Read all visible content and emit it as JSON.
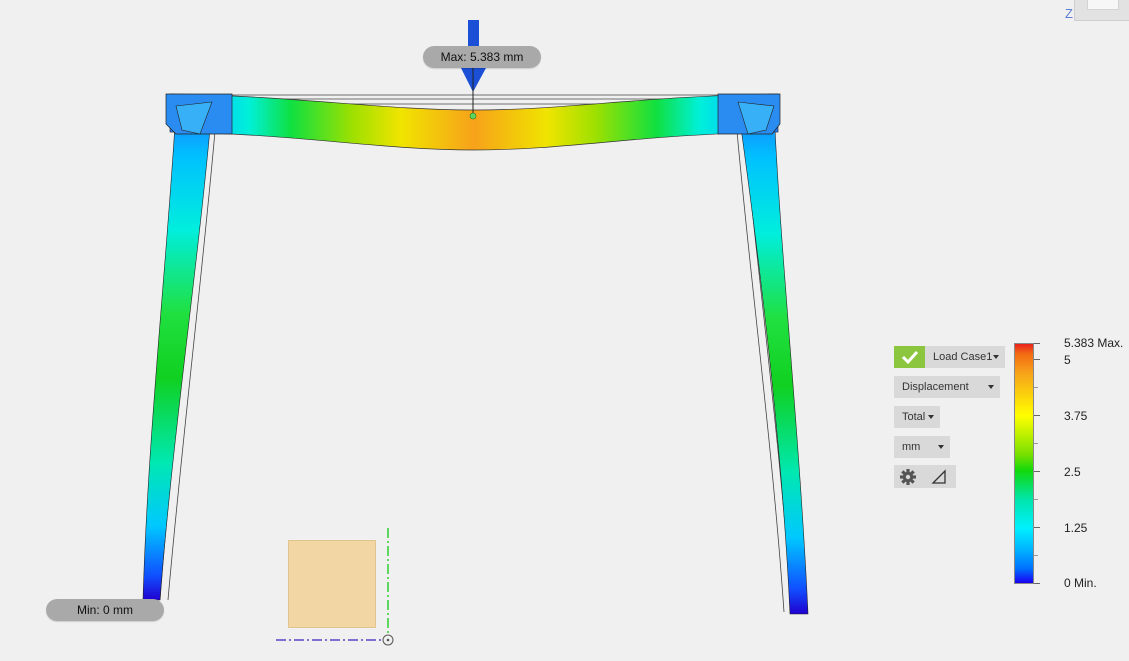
{
  "viewport": {
    "max_probe": "Max: 5.383 mm",
    "min_probe": "Min: 0 mm",
    "axis_label": "Z"
  },
  "controls": {
    "load_case": "Load Case1",
    "result_type": "Displacement",
    "component": "Total",
    "unit": "mm"
  },
  "legend": {
    "max_label": "5.383 Max.",
    "labels": [
      "5",
      "3.75",
      "2.5",
      "1.25"
    ],
    "min_label": "0 Min.",
    "colors": {
      "max": "#e8211c",
      "high": "#ffff00",
      "mid": "#12d80c",
      "low": "#00f0ff",
      "min": "#1a00f0"
    }
  },
  "icons": {
    "load_arrow": "down-arrow-icon",
    "settings": "gear-icon",
    "deform_scale": "triangle-ruler-icon",
    "check": "checkmark-icon"
  }
}
